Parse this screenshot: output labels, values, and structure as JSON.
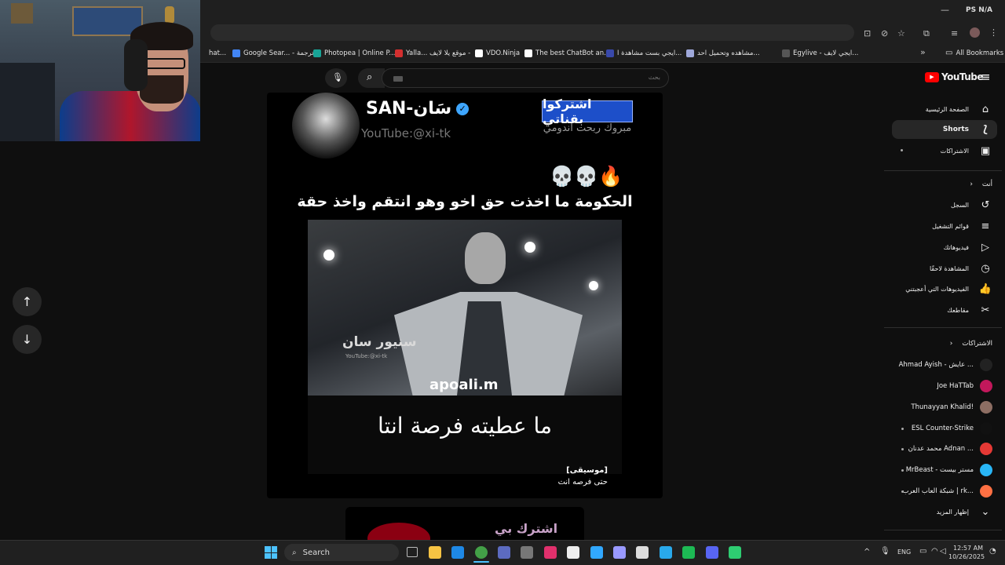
{
  "window": {
    "tray_right_icons": "PS N/A"
  },
  "bookmarks": [
    {
      "label": "hat...",
      "color": "#888"
    },
    {
      "label": "Google Sear... - ترجمة",
      "color": "#4285f4"
    },
    {
      "label": "Photopea | Online P...",
      "color": "#18a497"
    },
    {
      "label": "Yalla... موقع يلا لايف -",
      "color": "#d32f2f"
    },
    {
      "label": "VDO.Ninja",
      "color": "#ffffff"
    },
    {
      "label": "The best ChatBot an...",
      "color": "#ffffff"
    },
    {
      "label": "ايجي بست مشاهدة ا...",
      "color": "#3949ab"
    },
    {
      "label": "مشاهده وتحميل احد...",
      "color": "#9fa8da"
    },
    {
      "label": "Egylive - ايجي لايف...",
      "color": "#555"
    }
  ],
  "bookmarks_right": "All Bookmarks",
  "youtube": {
    "logo": "YouTube",
    "search_placeholder": "بحث",
    "sidebar": {
      "main": [
        {
          "label": "الصفحة الرئيسية",
          "icon": "home-icon",
          "glyph": "⌂"
        },
        {
          "label": "Shorts",
          "icon": "shorts-icon",
          "glyph": "⟆",
          "active": true
        },
        {
          "label": "الاشتراكات",
          "icon": "subscriptions-icon",
          "glyph": "▣"
        }
      ],
      "you_header": "أنت",
      "you": [
        {
          "label": "السجل",
          "icon": "history-icon",
          "glyph": "↺"
        },
        {
          "label": "قوائم التشغيل",
          "icon": "playlists-icon",
          "glyph": "≡"
        },
        {
          "label": "فيديوهاتك",
          "icon": "your-videos-icon",
          "glyph": "▷"
        },
        {
          "label": "المشاهدة لاحقًا",
          "icon": "watch-later-icon",
          "glyph": "◷"
        },
        {
          "label": "الفيديوهات التي أعجبتني",
          "icon": "liked-icon",
          "glyph": "👍"
        },
        {
          "label": "مقاطعك",
          "icon": "clips-icon",
          "glyph": "✂"
        }
      ],
      "subs_header": "الاشتراكات",
      "subscriptions": [
        {
          "label": "Ahmad Ayish - عايش ...",
          "color": "#222"
        },
        {
          "label": "Joe HaTTab",
          "color": "#c2185b"
        },
        {
          "label": "Thunayyan Khalid!",
          "color": "#8d6e63"
        },
        {
          "label": "ESL Counter-Strike",
          "color": "#111"
        },
        {
          "label": "محمد عدنان Adnan ...",
          "color": "#e53935"
        },
        {
          "label": "MrBeast - مستر بيست",
          "color": "#29b6f6"
        },
        {
          "label": "شبكة العاب العرب | rk...",
          "color": "#ff7043"
        }
      ],
      "show_more": "إظهار المزيد"
    }
  },
  "short": {
    "channel_name": "SAN-سَان",
    "handle": "YouTube:@xi-tk",
    "subscribe_banner": "اشتركوا بقناتي",
    "banner_sub": "مبروك ربحت اندومي",
    "emojis": "💀💀🔥",
    "headline": "الحكومة ما اخذت حق اخو وهو انتقم واخذ حقة",
    "watermark_arabic": "سنيور سان",
    "watermark_handle": "YouTube:@xi-tk",
    "watermark_big": "apoali.m",
    "subtitle": "ما عطيته فرصة انتا",
    "caption_line1": "[موسيقى]",
    "caption_line2": "حتى فرصه انت",
    "next_short_text": "اشترك بي"
  },
  "taskbar": {
    "search_label": "Search",
    "lang": "ENG",
    "time": "12:57 AM",
    "date": "10/26/2025",
    "apps": [
      {
        "name": "file-explorer-icon",
        "color": "#f6c343"
      },
      {
        "name": "edge-icon",
        "color": "#1e88e5"
      },
      {
        "name": "chrome-icon",
        "color": "#43a047"
      },
      {
        "name": "store-icon",
        "color": "#5c6bc0"
      },
      {
        "name": "phone-icon",
        "color": "#777"
      },
      {
        "name": "instagram-icon",
        "color": "#e1306c"
      },
      {
        "name": "capcut-icon",
        "color": "#eee"
      },
      {
        "name": "photoshop-icon",
        "color": "#31a8ff"
      },
      {
        "name": "premiere-icon",
        "color": "#9999ff"
      },
      {
        "name": "messenger-icon",
        "color": "#ddd"
      },
      {
        "name": "telegram-icon",
        "color": "#29a9eb"
      },
      {
        "name": "spotify-icon",
        "color": "#1db954"
      },
      {
        "name": "discord-icon",
        "color": "#5865f2"
      },
      {
        "name": "app-green-icon",
        "color": "#2ecc71"
      }
    ]
  }
}
